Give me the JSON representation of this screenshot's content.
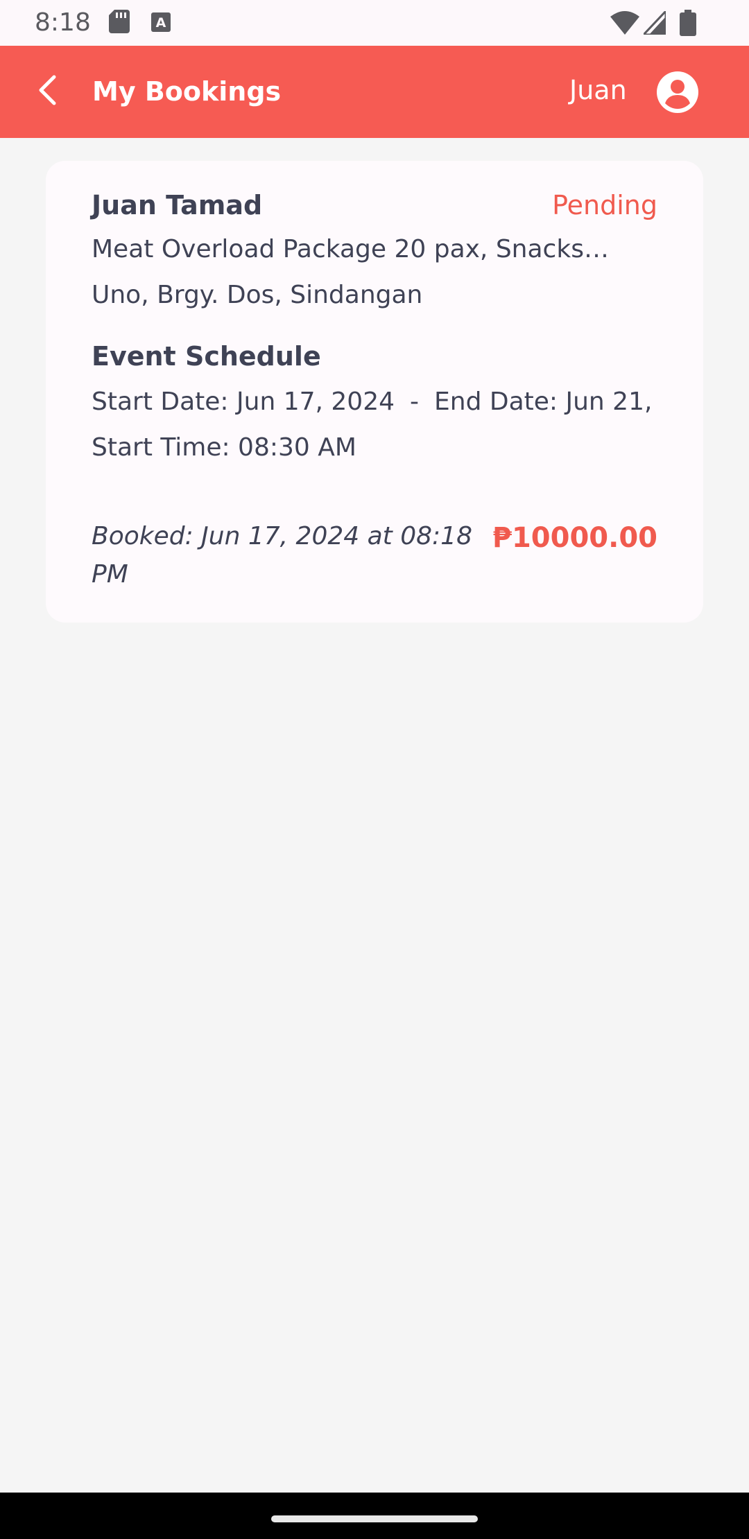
{
  "status_bar": {
    "time": "8:18",
    "icons": [
      "sd-card-icon",
      "keyboard-a-icon",
      "wifi-icon",
      "signal-icon",
      "battery-icon"
    ]
  },
  "app_bar": {
    "title": "My Bookings",
    "user_name": "Juan",
    "back_icon": "chevron-left-icon",
    "avatar_icon": "account-circle-icon",
    "background_color": "#f65b53"
  },
  "booking": {
    "customer_name": "Juan Tamad",
    "status": "Pending",
    "package": "Meat Overload Package 20 pax, Snacks…",
    "address": "Uno, Brgy. Dos, Sindangan",
    "schedule_heading": "Event Schedule",
    "start_date": "Start Date: Jun 17, 2024",
    "date_separator": "-",
    "end_date": "End Date: Jun 21,",
    "start_time": "Start Time: 08:30 AM",
    "booked": "Booked: Jun 17, 2024 at 08:18 PM",
    "price": "₱10000.00",
    "accent_color": "#f05a4e"
  }
}
